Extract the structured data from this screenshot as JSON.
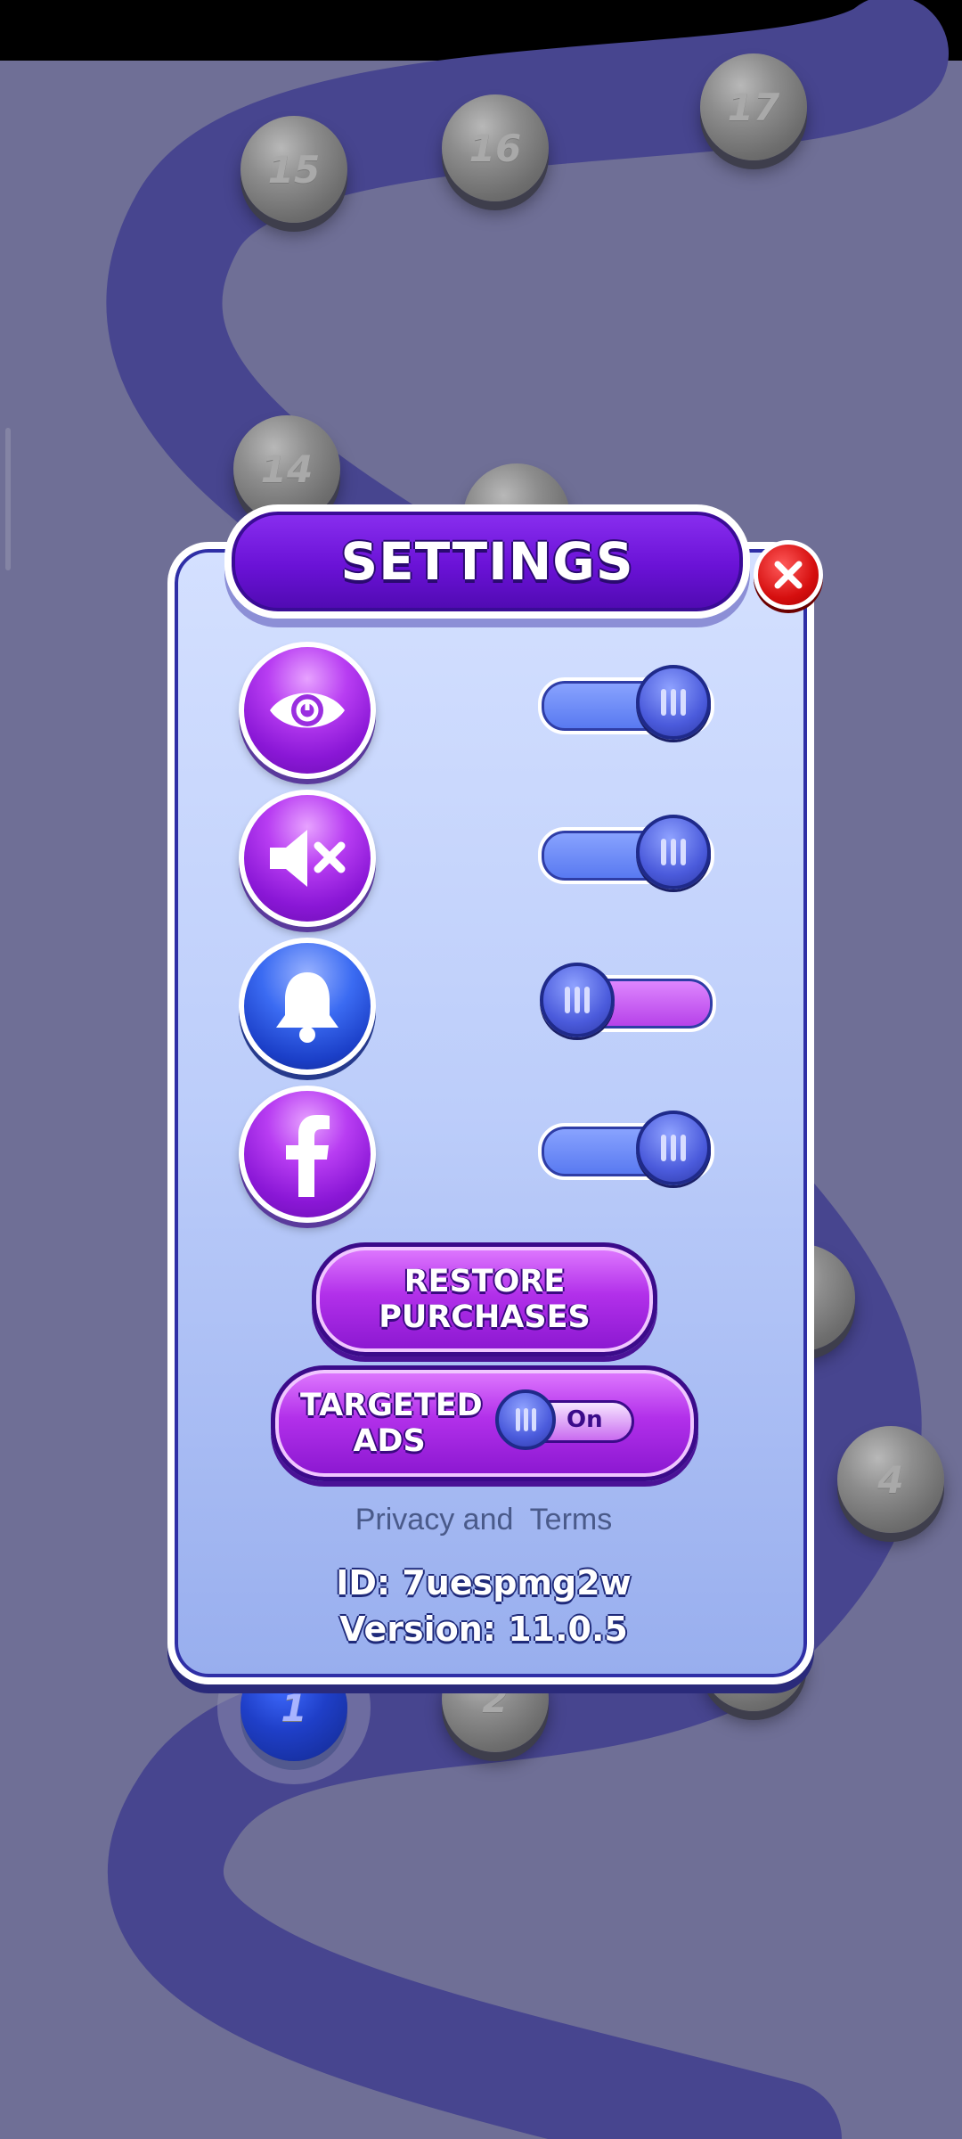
{
  "settings": {
    "title": "SETTINGS",
    "items": [
      {
        "icon": "eye-icon",
        "state": "on"
      },
      {
        "icon": "speaker-muted-icon",
        "state": "on"
      },
      {
        "icon": "bell-icon",
        "state": "off"
      },
      {
        "icon": "facebook-icon",
        "state": "on"
      }
    ],
    "restore_label": "RESTORE PURCHASES",
    "ads_label": "TARGETED ADS",
    "ads_toggle_text": "On",
    "privacy_label": "Privacy and",
    "terms_label": "Terms",
    "id_text": "ID: 7uespmg2w",
    "version_text": "Version: 11.0.5"
  },
  "map": {
    "levels": [
      "15",
      "16",
      "17",
      "14",
      "4",
      "1",
      "2"
    ],
    "current_level": "1"
  },
  "colors": {
    "background": "#6f6f96",
    "path": "#47458f",
    "accent_purple": "#8a17d6",
    "accent_blue": "#1b3fc8",
    "close_red": "#d60f0f"
  }
}
